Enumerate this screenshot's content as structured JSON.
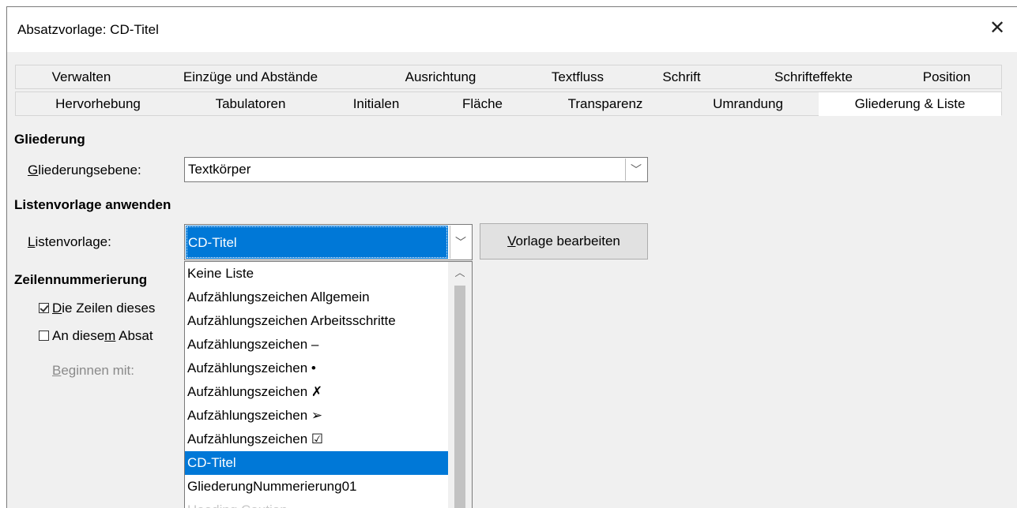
{
  "window": {
    "title": "Absatzvorlage: CD-Titel",
    "close_icon": "close-icon"
  },
  "tabs_row1": [
    "Verwalten",
    "Einzüge und Abstände",
    "Ausrichtung",
    "Textfluss",
    "Schrift",
    "Schrifteffekte",
    "Position"
  ],
  "tabs_row2": [
    "Hervorhebung",
    "Tabulatoren",
    "Initialen",
    "Fläche",
    "Transparenz",
    "Umrandung",
    "Gliederung & Liste"
  ],
  "active_tab": "Gliederung & Liste",
  "outline": {
    "heading": "Gliederung",
    "level_label_pre": "G",
    "level_label_rest": "liederungsebene:",
    "level_value": "Textkörper"
  },
  "list_style": {
    "heading": "Listenvorlage anwenden",
    "label_pre": "L",
    "label_rest": "istenvorlage:",
    "value": "CD-Titel",
    "edit_button_pre": "V",
    "edit_button_rest": "orlage bearbeiten",
    "options": [
      "Keine Liste",
      "Aufzählungszeichen Allgemein",
      "Aufzählungszeichen Arbeitsschritte",
      "Aufzählungszeichen –",
      "Aufzählungszeichen •",
      "Aufzählungszeichen ✗",
      "Aufzählungszeichen ➢",
      "Aufzählungszeichen ☑",
      "CD-Titel",
      "GliederungNummerierung01",
      "Heading Caution"
    ],
    "selected_option": "CD-Titel"
  },
  "line_numbering": {
    "heading": "Zeilennummerierung",
    "include_pre": "D",
    "include_rest": "ie Zeilen dieses",
    "include_checked": true,
    "restart_pre": "An diese",
    "restart_mid": "m",
    "restart_rest": " Absat",
    "restart_checked": false,
    "start_pre": "B",
    "start_rest": "eginnen mit:"
  },
  "colors": {
    "accent": "#0078d7",
    "dialog_bg": "#f0f0f0"
  }
}
